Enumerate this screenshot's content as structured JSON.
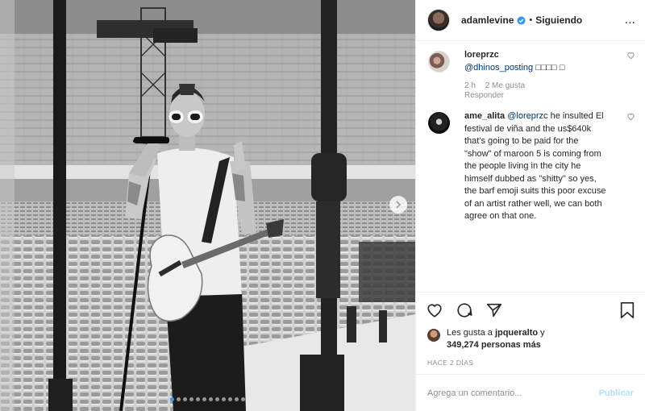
{
  "header": {
    "username": "adamlevine",
    "separator": "•",
    "follow_label": "Siguiendo",
    "more_label": "..."
  },
  "comments": [
    {
      "username": "loreprzc",
      "mention": "@dhinos_posting",
      "text": "□□□□ □",
      "time": "2 h",
      "likes": "2 Me gusta",
      "reply": "Responder"
    },
    {
      "username": "ame_alita",
      "mention": "@loreprzc",
      "text": "he insulted El festival de viña and the us$640k that's going to be paid for the \"show\" of maroon 5 is coming from the people living in the city he himself dubbed as \"shitty\" so yes, the barf emoji suits this poor excuse of an artist rather well, we can both agree on that one."
    }
  ],
  "likes": {
    "prefix": "Les gusta a",
    "user": "jpqueralto",
    "connector": "y",
    "others": "349,274 personas más"
  },
  "timestamp": "HACE 2 DÍAS",
  "add_comment": {
    "placeholder": "Agrega un comentario...",
    "publish_label": "Publicar"
  },
  "carousel": {
    "total": 12,
    "current": 1
  },
  "icons": {
    "verified": "verified-badge-icon",
    "like": "heart-icon",
    "comment": "comment-bubble-icon",
    "share": "paper-plane-icon",
    "save": "bookmark-icon",
    "next": "chevron-right-icon"
  },
  "colors": {
    "accent": "#3897f0",
    "mention": "#00376b",
    "muted": "#8e8e8e",
    "publish_disabled": "#b2dffc"
  }
}
